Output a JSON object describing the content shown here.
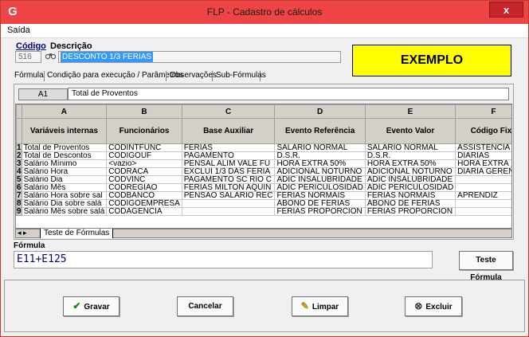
{
  "window": {
    "title": "FLP - Cadastro de cálculos",
    "close_label": "x"
  },
  "menu": {
    "saida": "Saída"
  },
  "header": {
    "codigo_label": "Código",
    "descricao_label": "Descrição",
    "codigo_value": "516",
    "descricao_value": "DESCONTO 1/3 FERIAS",
    "banner": "EXEMPLO"
  },
  "tabs": [
    "Fórmula",
    "Condição para execução / Parâmetros",
    "Observações",
    "Sub-Fórmulas"
  ],
  "cell": {
    "ref": "A1",
    "value": "Total de Proventos"
  },
  "grid": {
    "columns": [
      "A",
      "B",
      "C",
      "D",
      "E",
      "F"
    ],
    "column_titles": [
      "Variáveis internas",
      "Funcionários",
      "Base Auxiliar",
      "Evento Referência",
      "Evento Valor",
      "Código Fixo"
    ],
    "rows": [
      {
        "n": "1",
        "cells": [
          "Total de Proventos",
          "CODINTFUNC",
          "FERIAS",
          "SALARIO NORMAL",
          "SALARIO NORMAL",
          "ASSISTENCIA MED"
        ]
      },
      {
        "n": "2",
        "cells": [
          "Total de Descontos",
          "CODIGOUF",
          "PAGAMENTO",
          "D.S.R.",
          "D.S.R.",
          "DIARIAS"
        ]
      },
      {
        "n": "3",
        "cells": [
          "Salário Mínimo",
          "<vazio>",
          "PENSAL ALIM VALE FU",
          "HORA EXTRA 50%",
          "HORA EXTRA 50%",
          "HORA EXTRA"
        ]
      },
      {
        "n": "4",
        "cells": [
          "Salário Hora",
          "CODRACA",
          "EXCLUI 1/3 DAS FERIA",
          "ADICIONAL NOTURNO",
          "ADICIONAL NOTURNO",
          "DIARIA GERENCIA"
        ]
      },
      {
        "n": "5",
        "cells": [
          "Salário Dia",
          "CODVINC",
          "PAGAMENTO SC RIO C",
          "ADIC INSALUBRIDADE",
          "ADIC INSALUBRIDADE",
          ""
        ]
      },
      {
        "n": "6",
        "cells": [
          "Salário Mês",
          "CODREGIAO",
          "FERIAS MILTON AQUIN",
          "ADIC PERICULOSIDAD",
          "ADIC PERICULOSIDAD",
          ""
        ]
      },
      {
        "n": "7",
        "cells": [
          "Salário Hora sobre sal",
          "CODBANCO",
          "PENSAO SALARIO REC",
          "FERIAS NORMAIS",
          "FERIAS NORMAIS",
          "APRENDIZ"
        ]
      },
      {
        "n": "8",
        "cells": [
          "Salário Dia sobre salá",
          "CODIGOEMPRESA",
          "",
          "ABONO DE FERIAS",
          "ABONO DE FERIAS",
          ""
        ]
      },
      {
        "n": "9",
        "cells": [
          "Salário Mês sobre salá",
          "CODAGENCIA",
          "",
          "FERIAS PROPORCION",
          "FERIAS PROPORCION",
          ""
        ]
      }
    ],
    "sheet_tab": "Teste de Fórmulas"
  },
  "formula": {
    "label": "Fórmula",
    "value": "E11+E125",
    "test_button": "Teste Fórmula"
  },
  "buttons": {
    "gravar": "Gravar",
    "cancelar": "Cancelar",
    "limpar": "Limpar",
    "excluir": "Excluir"
  }
}
